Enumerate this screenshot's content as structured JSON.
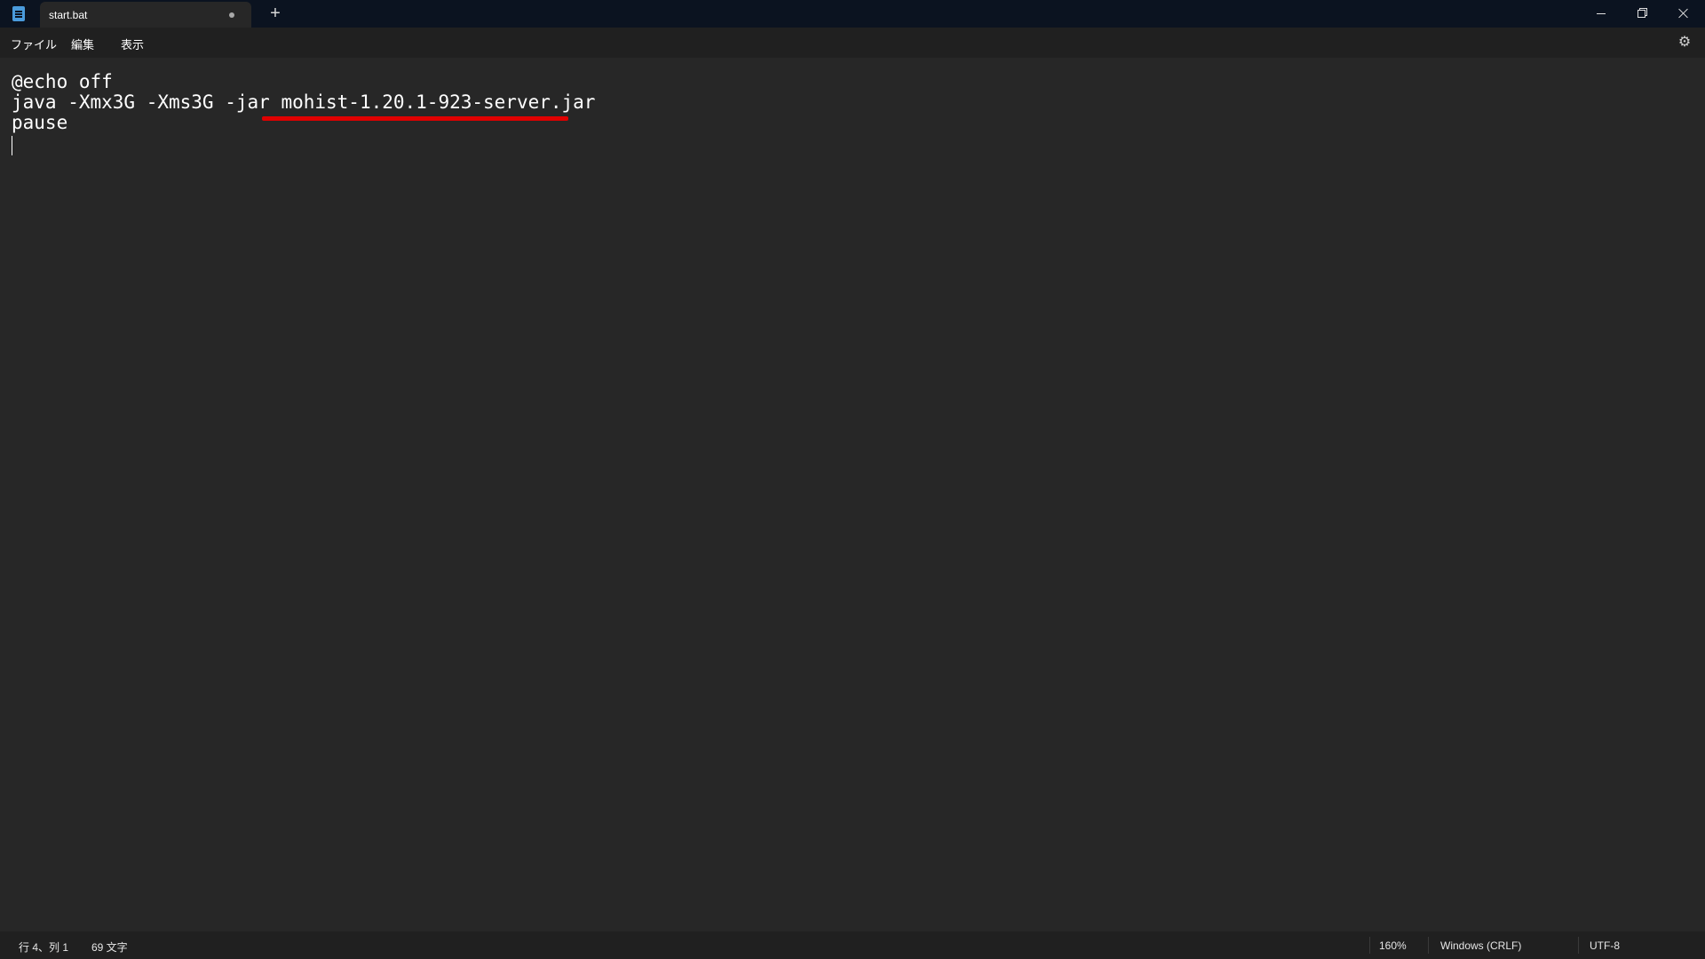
{
  "tab": {
    "title": "start.bat",
    "new_tab_label": "+"
  },
  "menu": {
    "file": "ファイル",
    "edit": "編集",
    "view": "表示"
  },
  "icons": {
    "app": "notepad-icon",
    "settings": "gear-icon",
    "settings_glyph": "⚙",
    "unsaved": "unsaved-dot-icon"
  },
  "editor": {
    "lines": [
      "@echo off",
      "java -Xmx3G -Xms3G -jar ",
      "pause"
    ],
    "highlighted_text": "mohist-1.20.1-923-server.jar",
    "highlight_color": "#e00000"
  },
  "status": {
    "position": "行 4、列 1",
    "char_count": "69 文字",
    "zoom": "160%",
    "line_ending": "Windows (CRLF)",
    "encoding": "UTF-8"
  },
  "colors": {
    "titlebar": "#0b1320",
    "editor_bg": "#272727",
    "menubar_bg": "#202020"
  }
}
